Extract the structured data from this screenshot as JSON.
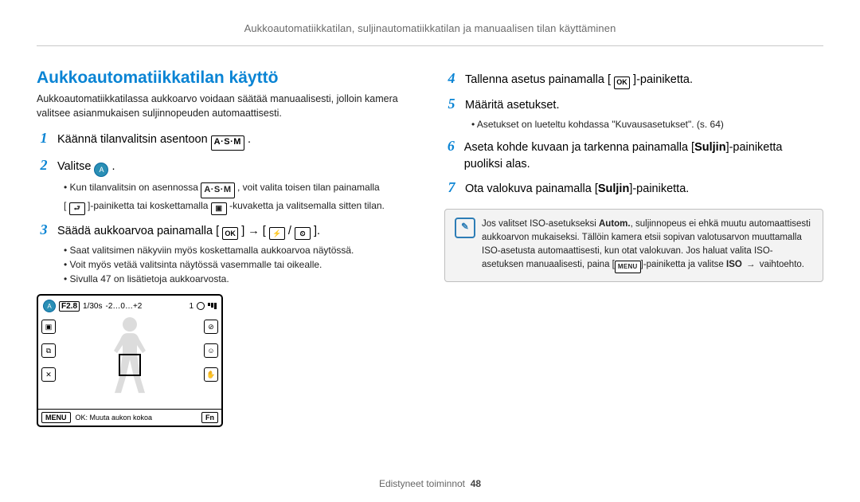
{
  "header": {
    "breadcrumb": "Aukkoautomatiikkatilan, suljinautomatiikkatilan ja manuaalisen tilan käyttäminen"
  },
  "left": {
    "title": "Aukkoautomatiikkatilan käyttö",
    "intro": "Aukkoautomatiikkatilassa aukkoarvo voidaan säätää manuaalisesti, jolloin kamera valitsee asianmukaisen suljinnopeuden automaattisesti.",
    "step1_pre": "Käännä tilanvalitsin asentoon ",
    "icon_asm": "A·S·M",
    "step1_post": ".",
    "step2_pre": "Valitse ",
    "step2_icon": "A",
    "step2_post": ".",
    "b1_pre": "Kun tilanvalitsin on asennossa ",
    "b1_post": ", voit valita toisen tilan painamalla",
    "b2_pre": "[",
    "b2_icon": "⮐",
    "b2_mid": "]-painiketta tai koskettamalla ",
    "b2_icon2": "▣",
    "b2_post": "-kuvaketta ja valitsemalla sitten tilan.",
    "step3_pre": "Säädä aukkoarvoa painamalla [",
    "step3_ok": "OK",
    "step3_mid": "] → [",
    "step3_ic1": "⚡",
    "step3_sep": "/",
    "step3_ic2": "⏲",
    "step3_post": "].",
    "s3_b1": "Saat valitsimen näkyviin myös koskettamalla aukkoarvoa näytössä.",
    "s3_b2": "Voit myös vetää valitsinta näytössä vasemmalle tai oikealle.",
    "s3_b3": "Sivulla 47 on lisätietoja aukkoarvosta.",
    "lcd": {
      "f": "F2.8",
      "s": "1/30s",
      "ev": "-2…0…+2",
      "count": "1",
      "bot_ok": "OK: Muuta aukon kokoa",
      "bot_menu": "MENU",
      "bot_fn": "Fn"
    }
  },
  "right": {
    "s4_n": "4",
    "s4_pre": "Tallenna asetus painamalla [",
    "s4_ok": "OK",
    "s4_post": "]-painiketta.",
    "s5_n": "5",
    "s5": "Määritä asetukset.",
    "s5_b": "Asetukset on lueteltu kohdassa \"Kuvausasetukset\". (s. 64)",
    "s6_n": "6",
    "s6_pre": "Aseta kohde kuvaan ja tarkenna painamalla [",
    "s6_strong": "Suljin",
    "s6_post": "]-painiketta puoliksi alas.",
    "s7_n": "7",
    "s7_pre": "Ota valokuva painamalla [",
    "s7_strong": "Suljin",
    "s7_post": "]-painiketta.",
    "note_pre": "Jos valitset ISO-asetukseksi ",
    "note_strong1": "Autom.",
    "note_mid1": ", suljinnopeus ei ehkä muutu automaattisesti aukkoarvon mukaiseksi. Tällöin kamera etsii sopivan valotusarvon muuttamalla ISO-asetusta automaattisesti, kun otat valokuvan. Jos haluat valita ISO-asetuksen manuaalisesti, paina [",
    "note_menu": "MENU",
    "note_mid2": "]-painiketta ja valitse ",
    "note_strong2": "ISO",
    "note_arrow": " → ",
    "note_post": "vaihtoehto."
  },
  "footer": {
    "text": "Edistyneet toiminnot",
    "page": "48"
  }
}
